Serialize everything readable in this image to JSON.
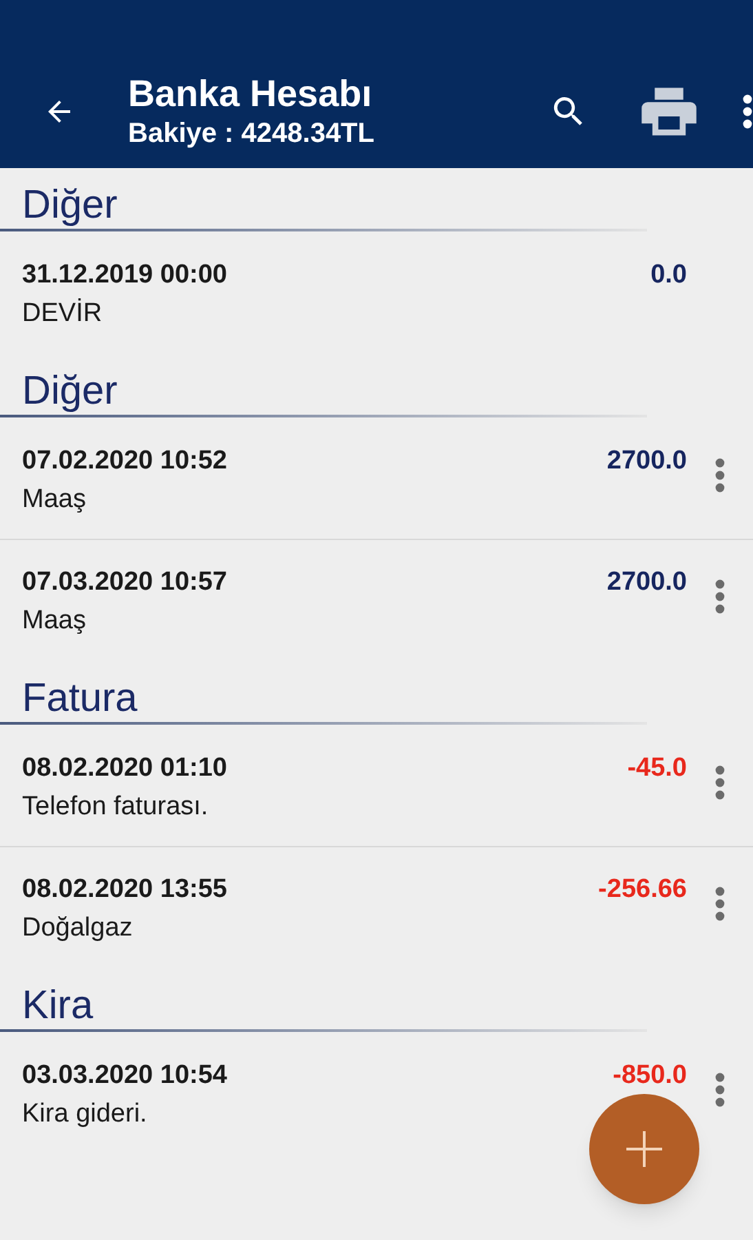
{
  "app_bar": {
    "title": "Banka Hesabı",
    "subtitle": "Bakiye : 4248.34TL"
  },
  "sections": [
    {
      "title": "Diğer",
      "entries": [
        {
          "date": "31.12.2019 00:00",
          "description": "DEVİR",
          "amount": "0.0",
          "negative": false,
          "has_menu": false
        }
      ]
    },
    {
      "title": "Diğer",
      "entries": [
        {
          "date": "07.02.2020 10:52",
          "description": "Maaş",
          "amount": "2700.0",
          "negative": false,
          "has_menu": true
        },
        {
          "date": "07.03.2020 10:57",
          "description": "Maaş",
          "amount": "2700.0",
          "negative": false,
          "has_menu": true
        }
      ]
    },
    {
      "title": "Fatura",
      "entries": [
        {
          "date": "08.02.2020 01:10",
          "description": "Telefon faturası.",
          "amount": "-45.0",
          "negative": true,
          "has_menu": true
        },
        {
          "date": "08.02.2020 13:55",
          "description": "Doğalgaz",
          "amount": "-256.66",
          "negative": true,
          "has_menu": true
        }
      ]
    },
    {
      "title": "Kira",
      "entries": [
        {
          "date": "03.03.2020 10:54",
          "description": "Kira gideri.",
          "amount": "-850.0",
          "negative": true,
          "has_menu": true
        }
      ]
    }
  ]
}
